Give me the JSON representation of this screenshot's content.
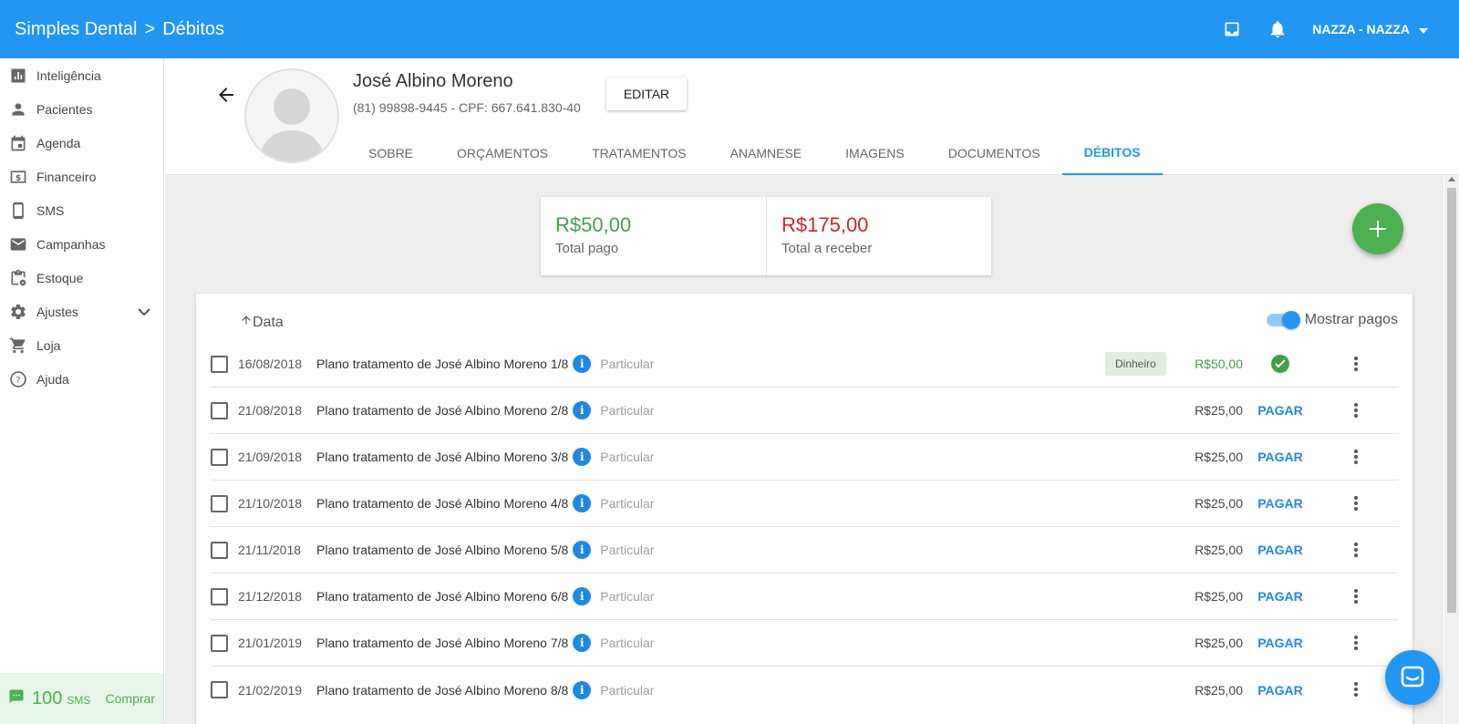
{
  "topbar": {
    "app_name": "Simples Dental",
    "separator": ">",
    "page": "Débitos",
    "user": "NAZZA - NAZZA",
    "icons": [
      "inbox-icon",
      "bell-icon",
      "caret-down-icon"
    ]
  },
  "sidebar": {
    "items": [
      {
        "label": "Inteligência",
        "icon": "bar-chart-icon"
      },
      {
        "label": "Pacientes",
        "icon": "person-icon"
      },
      {
        "label": "Agenda",
        "icon": "calendar-icon"
      },
      {
        "label": "Financeiro",
        "icon": "money-icon"
      },
      {
        "label": "SMS",
        "icon": "phone-icon"
      },
      {
        "label": "Campanhas",
        "icon": "mail-icon"
      },
      {
        "label": "Estoque",
        "icon": "clipboard-check-icon"
      },
      {
        "label": "Ajustes",
        "icon": "gear-icon"
      },
      {
        "label": "Loja",
        "icon": "cart-icon"
      },
      {
        "label": "Ajuda",
        "icon": "help-icon"
      }
    ],
    "sms": {
      "count": "100",
      "label": "SMS",
      "buy": "Comprar"
    }
  },
  "patient": {
    "name": "José Albino Moreno",
    "info": "(81) 99898-9445 - CPF: 667.641.830-40",
    "edit": "EDITAR"
  },
  "tabs": [
    {
      "label": "SOBRE",
      "active": false
    },
    {
      "label": "ORÇAMENTOS",
      "active": false
    },
    {
      "label": "TRATAMENTOS",
      "active": false
    },
    {
      "label": "ANAMNESE",
      "active": false
    },
    {
      "label": "IMAGENS",
      "active": false
    },
    {
      "label": "DOCUMENTOS",
      "active": false
    },
    {
      "label": "DÉBITOS",
      "active": true
    }
  ],
  "summary": {
    "paid_value": "R$50,00",
    "paid_label": "Total pago",
    "receivable_value": "R$175,00",
    "receivable_label": "Total a receber"
  },
  "list": {
    "sort_label": "Data",
    "toggle_label": "Mostrar pagos",
    "toggle_on": true,
    "rows": [
      {
        "date": "16/08/2018",
        "desc": "Plano tratamento de José Albino Moreno 1/8",
        "insurance": "Particular",
        "method": "Dinheiro",
        "amount": "R$50,00",
        "paid": true
      },
      {
        "date": "21/08/2018",
        "desc": "Plano tratamento de José Albino Moreno 2/8",
        "insurance": "Particular",
        "amount": "R$25,00",
        "action": "PAGAR"
      },
      {
        "date": "21/09/2018",
        "desc": "Plano tratamento de José Albino Moreno 3/8",
        "insurance": "Particular",
        "amount": "R$25,00",
        "action": "PAGAR"
      },
      {
        "date": "21/10/2018",
        "desc": "Plano tratamento de José Albino Moreno 4/8",
        "insurance": "Particular",
        "amount": "R$25,00",
        "action": "PAGAR"
      },
      {
        "date": "21/11/2018",
        "desc": "Plano tratamento de José Albino Moreno 5/8",
        "insurance": "Particular",
        "amount": "R$25,00",
        "action": "PAGAR"
      },
      {
        "date": "21/12/2018",
        "desc": "Plano tratamento de José Albino Moreno 6/8",
        "insurance": "Particular",
        "amount": "R$25,00",
        "action": "PAGAR"
      },
      {
        "date": "21/01/2019",
        "desc": "Plano tratamento de José Albino Moreno 7/8",
        "insurance": "Particular",
        "amount": "R$25,00",
        "action": "PAGAR"
      },
      {
        "date": "21/02/2019",
        "desc": "Plano tratamento de José Albino Moreno 8/8",
        "insurance": "Particular",
        "amount": "R$25,00",
        "action": "PAGAR"
      }
    ]
  },
  "colors": {
    "primary": "#2196f3",
    "paid_green": "#43a047",
    "receivable_red": "#c62828",
    "fab_green": "#4caf50"
  }
}
